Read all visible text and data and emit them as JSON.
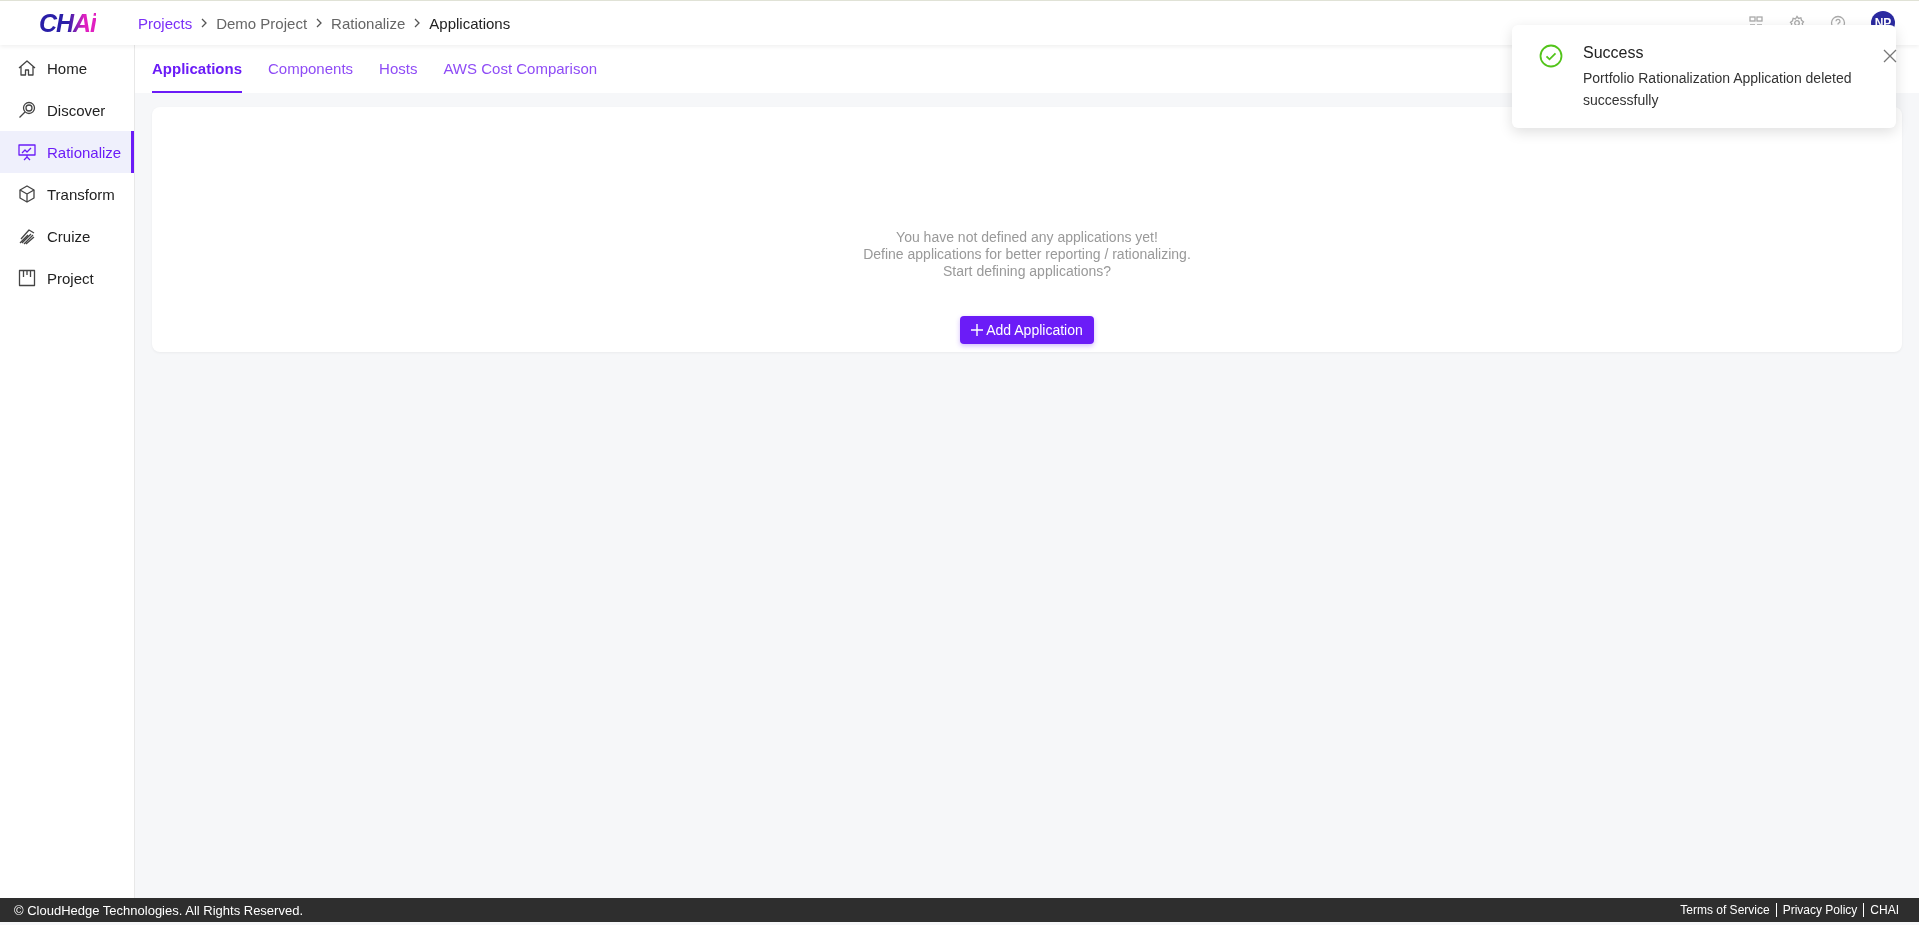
{
  "logo": "CHAi",
  "breadcrumb": [
    {
      "label": "Projects",
      "kind": "link"
    },
    {
      "label": "Demo Project",
      "kind": "crumb"
    },
    {
      "label": "Rationalize",
      "kind": "crumb"
    },
    {
      "label": "Applications",
      "kind": "current"
    }
  ],
  "user": {
    "initials": "NP"
  },
  "sidebar": {
    "items": [
      {
        "label": "Home",
        "kind": "home",
        "selected": false
      },
      {
        "label": "Discover",
        "kind": "discover",
        "selected": false
      },
      {
        "label": "Rationalize",
        "kind": "rationalize",
        "selected": true
      },
      {
        "label": "Transform",
        "kind": "transform",
        "selected": false
      },
      {
        "label": "Cruize",
        "kind": "cruize",
        "selected": false
      },
      {
        "label": "Project",
        "kind": "project",
        "selected": false
      }
    ]
  },
  "tabs": [
    {
      "label": "Applications",
      "selected": true
    },
    {
      "label": "Components",
      "selected": false
    },
    {
      "label": "Hosts",
      "selected": false
    },
    {
      "label": "AWS Cost Comparison",
      "selected": false
    }
  ],
  "empty_state": {
    "lines": [
      "You have not defined any applications yet!",
      "Define applications for better reporting / rationalizing.",
      "Start defining applications?"
    ],
    "button": "Add Application"
  },
  "toast": {
    "title": "Success",
    "message": "Portfolio Rationalization Application deleted successfully"
  },
  "footer": {
    "copyright": "© CloudHedge Technologies. All Rights Reserved.",
    "links": [
      "Terms of Service",
      "Privacy Policy",
      "CHAI"
    ]
  }
}
